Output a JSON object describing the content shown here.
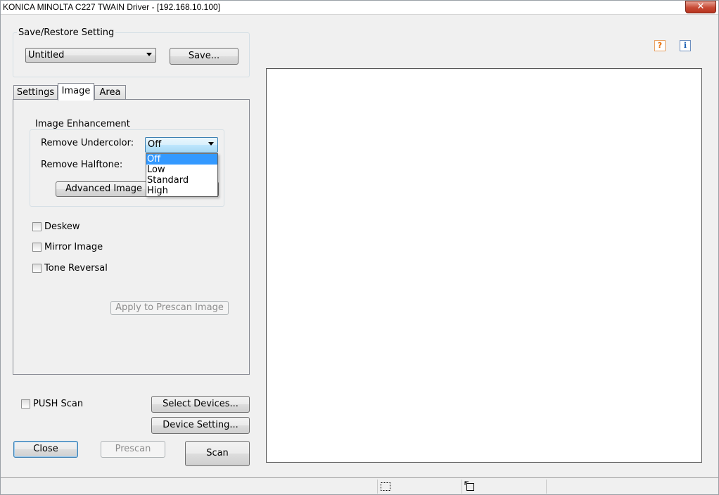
{
  "window": {
    "title": "KONICA MINOLTA C227 TWAIN Driver - [192.168.10.100]",
    "close_glyph": "✕"
  },
  "save_restore": {
    "label": "Save/Restore Setting",
    "selected": "Untitled",
    "save_button": "Save..."
  },
  "tabs": [
    {
      "label": "Settings",
      "active": false
    },
    {
      "label": "Image",
      "active": true
    },
    {
      "label": "Area",
      "active": false
    }
  ],
  "image_enhancement": {
    "label": "Image Enhancement",
    "remove_undercolor": {
      "label": "Remove Undercolor:",
      "value": "Off"
    },
    "remove_halftone": {
      "label": "Remove Halftone:"
    },
    "advanced_button": "Advanced Image E",
    "dropdown_options": [
      "Off",
      "Low",
      "Standard",
      "High"
    ],
    "dropdown_selected": "Off"
  },
  "checkboxes": {
    "deskew": {
      "label": "Deskew",
      "checked": false
    },
    "mirror": {
      "label": "Mirror Image",
      "checked": false
    },
    "tone": {
      "label": "Tone Reversal",
      "checked": false
    }
  },
  "apply_button": "Apply to Prescan Image",
  "push_scan": {
    "label": "PUSH Scan",
    "checked": false
  },
  "buttons": {
    "select_devices": "Select Devices...",
    "device_setting": "Device Setting...",
    "close": "Close",
    "prescan": "Prescan",
    "scan": "Scan"
  },
  "help_icons": {
    "help": "?",
    "info": "i"
  },
  "colors": {
    "selection": "#3399ff",
    "help_icon": "#e8700a",
    "info_icon": "#1a5fb4"
  }
}
